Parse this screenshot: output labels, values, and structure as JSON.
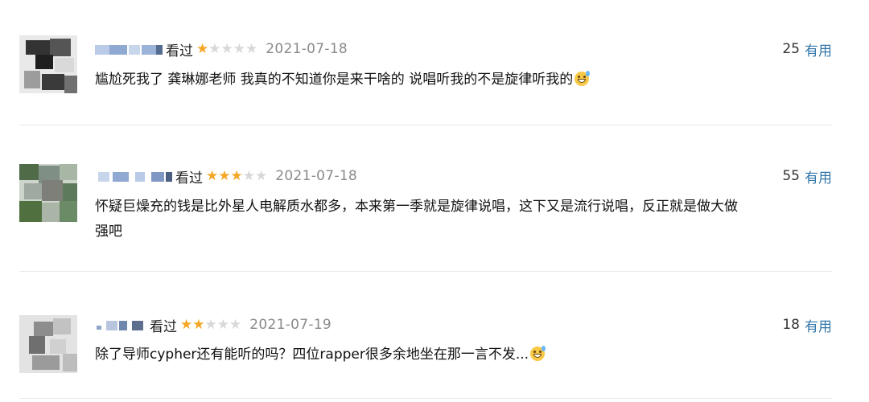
{
  "comments": [
    {
      "status": "看过",
      "rating": 1,
      "date": "2021-07-18",
      "useful_count": "25",
      "useful_label": "有用",
      "text": "尴尬死我了 龚琳娜老师 我真的不知道你是来干啥的 说唱听我的不是旋律听我的",
      "emoji": "grinning-sweat-emoji"
    },
    {
      "status": "看过",
      "rating": 3,
      "date": "2021-07-18",
      "useful_count": "55",
      "useful_label": "有用",
      "text_line1": "怀疑巨燥充的钱是比外星人电解质水都多，本来第一季就是旋律说唱，这下又是流行说唱，反正就是做大做",
      "text_line2": "强吧"
    },
    {
      "status": "看过",
      "rating": 2,
      "date": "2021-07-19",
      "useful_count": "18",
      "useful_label": "有用",
      "text": "除了导师cypher还有能听的吗？四位rapper很多余地坐在那一言不发...",
      "emoji": "grinning-sweat-emoji"
    }
  ],
  "colors": {
    "star_on": "#f5a623",
    "star_off": "#d8d8d8",
    "useful_link": "#3377aa",
    "date": "#8a8a8a",
    "divider": "#e8e8e8"
  }
}
